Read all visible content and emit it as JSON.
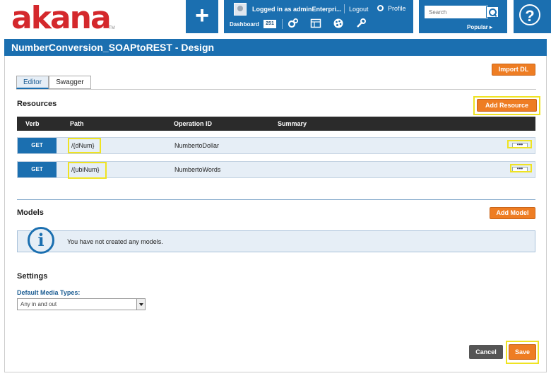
{
  "header": {
    "logo_text": "akana",
    "logo_tm": "TM",
    "add_label": "+",
    "user": {
      "logged_in_text": "Logged in as adminEnterpri...",
      "logout_label": "Logout",
      "profile_label": "Profile",
      "dashboard_label": "Dashboard",
      "dashboard_count": "251",
      "toolbar_icons": [
        "gears-icon",
        "layout-icon",
        "palette-icon",
        "wrench-icon"
      ]
    },
    "search": {
      "placeholder": "Search",
      "popular_label": "Popular ▸"
    },
    "help_label": "?"
  },
  "page": {
    "title": "NumberConversion_SOAPtoREST - Design"
  },
  "toolbar": {
    "import_dl_label": "Import DL"
  },
  "tabs": [
    {
      "label": "Editor",
      "active": true
    },
    {
      "label": "Swagger",
      "active": false
    }
  ],
  "resources": {
    "title": "Resources",
    "add_label": "Add Resource",
    "columns": [
      "Verb",
      "Path",
      "Operation ID",
      "Summary"
    ],
    "rows": [
      {
        "verb": "GET",
        "path": "/{dNum}",
        "operation_id": "NumbertoDollar",
        "summary": "",
        "menu": "•••"
      },
      {
        "verb": "GET",
        "path": "/{ubiNum}",
        "operation_id": "NumbertoWords",
        "summary": "",
        "menu": "•••"
      }
    ]
  },
  "models": {
    "title": "Models",
    "add_label": "Add Model",
    "info_icon": "i",
    "empty_text": "You have not created any models."
  },
  "settings": {
    "title": "Settings",
    "media_types_label": "Default Media Types:",
    "media_types_value": "Any in and out"
  },
  "footer": {
    "cancel_label": "Cancel",
    "save_label": "Save"
  },
  "colors": {
    "brand_red": "#d4282c",
    "header_blue": "#1b6fb0",
    "orange": "#ee7d23",
    "highlight_yellow": "#f0e62a"
  }
}
